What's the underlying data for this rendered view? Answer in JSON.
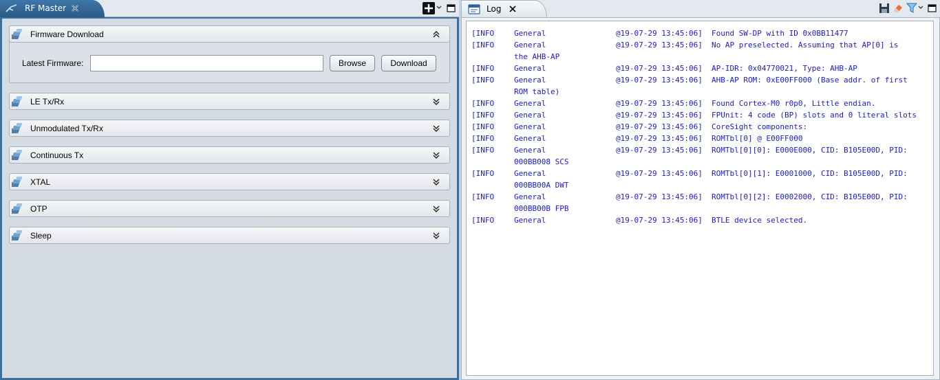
{
  "left_view": {
    "tab_title": "RF Master",
    "tab_icon": "rf-master-icon",
    "sections": [
      {
        "title": "Firmware Download",
        "expanded": true
      },
      {
        "title": "LE Tx/Rx",
        "expanded": false
      },
      {
        "title": "Unmodulated Tx/Rx",
        "expanded": false
      },
      {
        "title": "Continuous Tx",
        "expanded": false
      },
      {
        "title": "XTAL",
        "expanded": false
      },
      {
        "title": "OTP",
        "expanded": false
      },
      {
        "title": "Sleep",
        "expanded": false
      }
    ],
    "firmware": {
      "label": "Latest Firmware:",
      "value": "",
      "placeholder": "",
      "browse_label": "Browse",
      "download_label": "Download"
    }
  },
  "right_view": {
    "tab_title": "Log",
    "log": [
      {
        "level": "[INFO",
        "source": "General",
        "time": "@19-07-29 13:45:06]",
        "msg": "Found SW-DP with ID 0x0BB11477",
        "cont": ""
      },
      {
        "level": "[INFO",
        "source": "General",
        "time": "@19-07-29 13:45:06]",
        "msg": "No AP preselected. Assuming that AP[0] is",
        "cont": "the AHB-AP"
      },
      {
        "level": "[INFO",
        "source": "General",
        "time": "@19-07-29 13:45:06]",
        "msg": "AP-IDR: 0x04770021, Type: AHB-AP",
        "cont": ""
      },
      {
        "level": "[INFO",
        "source": "General",
        "time": "@19-07-29 13:45:06]",
        "msg": "AHB-AP ROM: 0xE00FF000 (Base addr. of first",
        "cont": "ROM table)"
      },
      {
        "level": "[INFO",
        "source": "General",
        "time": "@19-07-29 13:45:06]",
        "msg": "Found Cortex-M0 r0p0, Little endian.",
        "cont": ""
      },
      {
        "level": "[INFO",
        "source": "General",
        "time": "@19-07-29 13:45:06]",
        "msg": "FPUnit: 4 code (BP) slots and 0 literal slots",
        "cont": ""
      },
      {
        "level": "[INFO",
        "source": "General",
        "time": "@19-07-29 13:45:06]",
        "msg": "CoreSight components:",
        "cont": ""
      },
      {
        "level": "[INFO",
        "source": "General",
        "time": "@19-07-29 13:45:06]",
        "msg": "ROMTbl[0] @ E00FF000",
        "cont": ""
      },
      {
        "level": "[INFO",
        "source": "General",
        "time": "@19-07-29 13:45:06]",
        "msg": "ROMTbl[0][0]: E000E000, CID: B105E00D, PID:",
        "cont": "000BB008 SCS"
      },
      {
        "level": "[INFO",
        "source": "General",
        "time": "@19-07-29 13:45:06]",
        "msg": "ROMTbl[0][1]: E0001000, CID: B105E00D, PID:",
        "cont": "000BB00A DWT"
      },
      {
        "level": "[INFO",
        "source": "General",
        "time": "@19-07-29 13:45:06]",
        "msg": "ROMTbl[0][2]: E0002000, CID: B105E00D, PID:",
        "cont": "000BB00B FPB"
      },
      {
        "level": "[INFO",
        "source": "General",
        "time": "@19-07-29 13:45:06]",
        "msg": "BTLE device selected.",
        "cont": ""
      }
    ]
  },
  "colors": {
    "accent": "#2f6696",
    "log_text": "#1a1ad6"
  }
}
